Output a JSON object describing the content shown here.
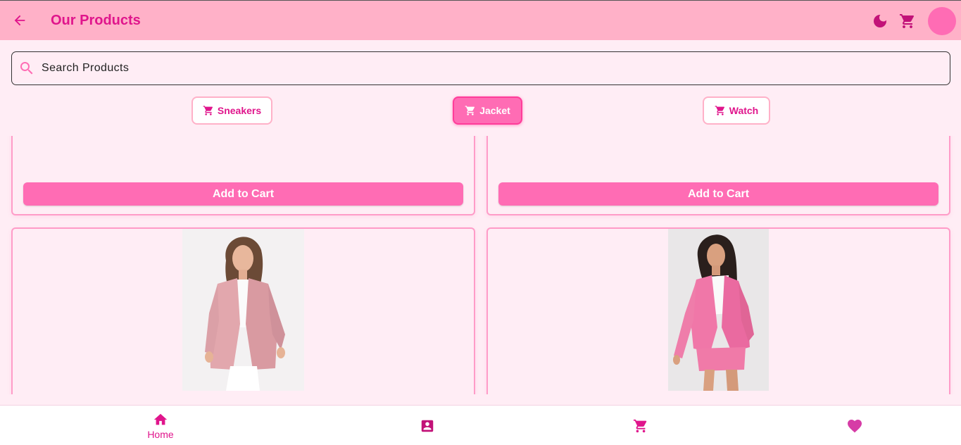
{
  "appbar": {
    "title": "Our Products"
  },
  "search": {
    "placeholder": "Search Products"
  },
  "categories": [
    {
      "label": "Sneakers",
      "active": false
    },
    {
      "label": "Jacket",
      "active": true
    },
    {
      "label": "Watch",
      "active": false
    }
  ],
  "cards_top": [
    {
      "button_label": "Add to Cart"
    },
    {
      "button_label": "Add to Cart"
    }
  ],
  "cards_bottom": [
    {
      "image": "pink-blazer-white-pants-photo"
    },
    {
      "image": "pink-blazer-shorts-set-photo"
    }
  ],
  "bottom_nav": [
    {
      "label": "Home",
      "icon": "home-icon",
      "active": true
    },
    {
      "label": "",
      "icon": "contact-icon",
      "active": false
    },
    {
      "label": "",
      "icon": "cart-icon",
      "active": false
    },
    {
      "label": "",
      "icon": "heart-icon",
      "active": false
    }
  ],
  "colors": {
    "primary": "#e0158c",
    "appbar": "#ffb1c8",
    "accent": "#ff6cb4",
    "background": "#ffedf5"
  }
}
